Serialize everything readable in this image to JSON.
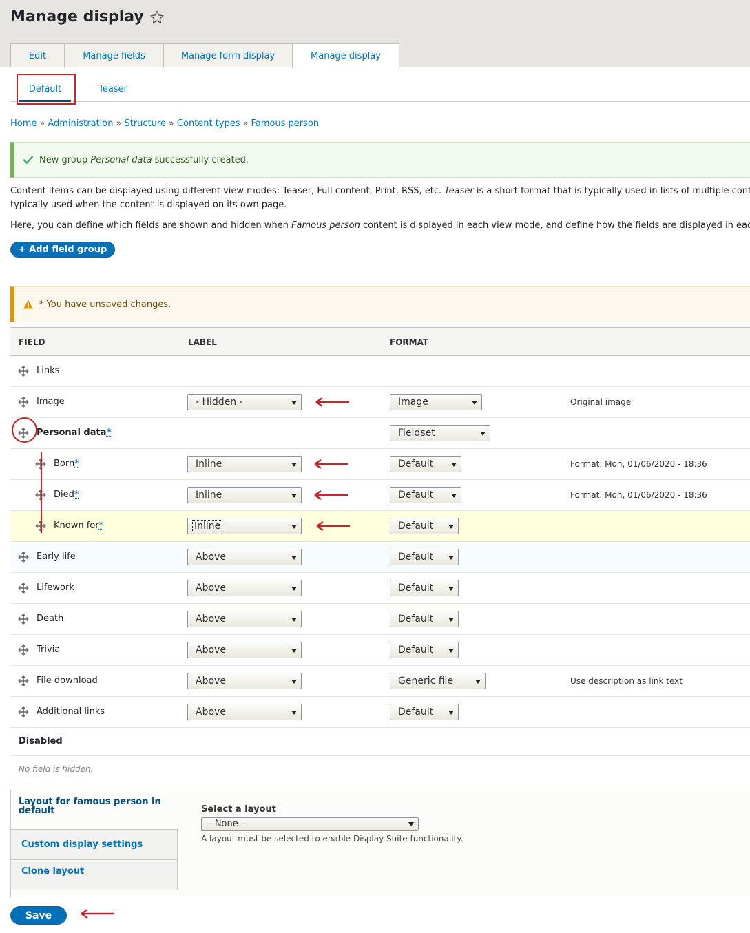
{
  "header": {
    "title": "Manage display",
    "tabs": [
      "Edit",
      "Manage fields",
      "Manage form display",
      "Manage display"
    ],
    "active_tab": "Manage display"
  },
  "secondary_tabs": {
    "items": [
      "Default",
      "Teaser"
    ],
    "active": "Default"
  },
  "breadcrumb": [
    "Home",
    "Administration",
    "Structure",
    "Content types",
    "Famous person"
  ],
  "status_message": {
    "prefix": "New group ",
    "group": "Personal data",
    "suffix": " successfully created."
  },
  "description": {
    "line1_a": "Content items can be displayed using different view modes: Teaser, Full content, Print, RSS, etc. ",
    "line1_em": "Teaser",
    "line1_b": " is a short format that is typically used in lists of multiple cont",
    "line2": "typically used when the content is displayed on its own page.",
    "line3_a": "Here, you can define which fields are shown and hidden when ",
    "line3_em": "Famous person",
    "line3_b": " content is displayed in each view mode, and define how the fields are displayed in eac"
  },
  "add_group_button": "+ Add field group",
  "warning_message": {
    "asterisk": "*",
    "text": " You have unsaved changes."
  },
  "table": {
    "headers": {
      "field": "FIELD",
      "label": "LABEL",
      "format": "FORMAT"
    },
    "rows": [
      {
        "field": "Links",
        "label": "",
        "format": "",
        "summary": ""
      },
      {
        "field": "Image",
        "label": "- Hidden -",
        "format": "Image",
        "summary": "Original image"
      },
      {
        "field": "Personal data",
        "label": "",
        "format": "Fieldset",
        "summary": ""
      },
      {
        "field": "Born",
        "label": "Inline",
        "format": "Default",
        "summary": "Format: Mon, 01/06/2020 - 18:36"
      },
      {
        "field": "Died",
        "label": "Inline",
        "format": "Default",
        "summary": "Format: Mon, 01/06/2020 - 18:36"
      },
      {
        "field": "Known for",
        "label": "Inline",
        "format": "Default",
        "summary": ""
      },
      {
        "field": "Early life",
        "label": "Above",
        "format": "Default",
        "summary": ""
      },
      {
        "field": "Lifework",
        "label": "Above",
        "format": "Default",
        "summary": ""
      },
      {
        "field": "Death",
        "label": "Above",
        "format": "Default",
        "summary": ""
      },
      {
        "field": "Trivia",
        "label": "Above",
        "format": "Default",
        "summary": ""
      },
      {
        "field": "File download",
        "label": "Above",
        "format": "Generic file",
        "summary": "Use description as link text"
      },
      {
        "field": "Additional links",
        "label": "Above",
        "format": "Default",
        "summary": ""
      }
    ],
    "asterisk": "*",
    "disabled_heading": "Disabled",
    "no_hidden_text": "No field is hidden."
  },
  "vertical_tabs": {
    "items": [
      "Layout for famous person in default",
      "Custom display settings",
      "Clone layout"
    ],
    "select_label": "Select a layout",
    "select_value": "- None -",
    "help": "A layout must be selected to enable Display Suite functionality."
  },
  "save_button": "Save",
  "colors": {
    "link": "#0074bd",
    "primary_button": "#0071b8",
    "annotation": "#c4262e"
  }
}
